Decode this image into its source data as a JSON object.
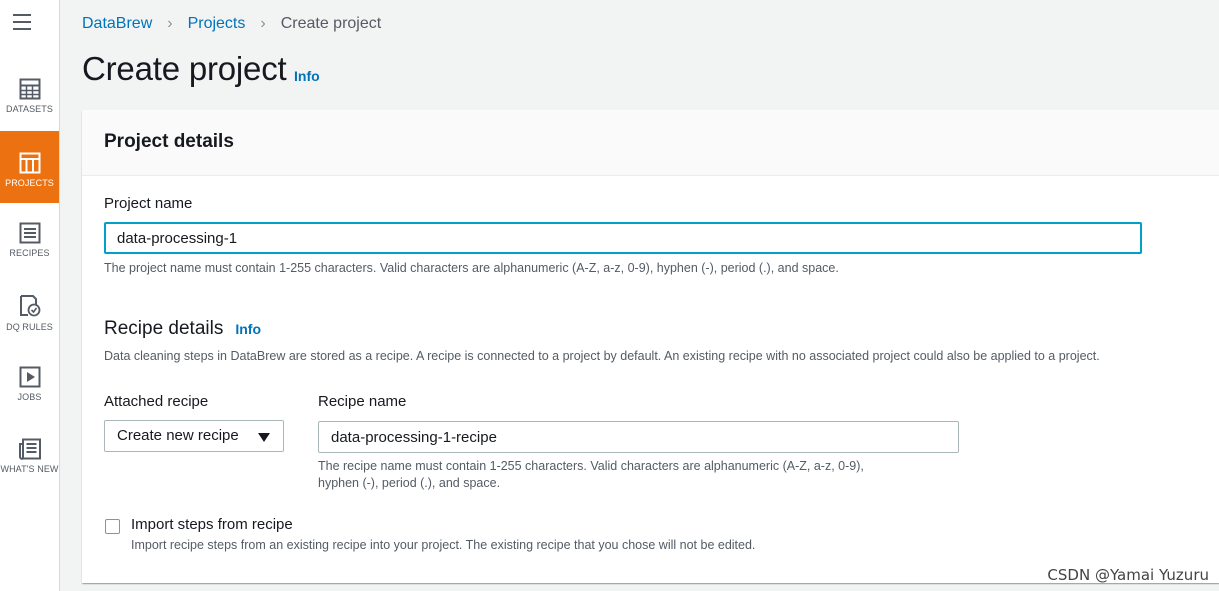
{
  "nav": {
    "items": [
      {
        "label": "DATASETS",
        "icon": "table-icon",
        "active": false
      },
      {
        "label": "PROJECTS",
        "icon": "grid-icon",
        "active": true
      },
      {
        "label": "RECIPES",
        "icon": "list-icon",
        "active": false
      },
      {
        "label": "DQ RULES",
        "icon": "rule-check-icon",
        "active": false
      },
      {
        "label": "JOBS",
        "icon": "play-icon",
        "active": false
      },
      {
        "label": "WHAT'S NEW",
        "icon": "newspaper-icon",
        "active": false
      }
    ],
    "active_color": "#ec7211"
  },
  "breadcrumb": {
    "items": [
      "DataBrew",
      "Projects"
    ],
    "current": "Create project"
  },
  "page": {
    "title": "Create project",
    "info_label": "Info"
  },
  "project_details": {
    "header": "Project details",
    "name_label": "Project name",
    "name_value": "data-processing-1",
    "name_hint": "The project name must contain 1-255 characters. Valid characters are alphanumeric (A-Z, a-z, 0-9), hyphen (-), period (.), and space."
  },
  "recipe_details": {
    "title": "Recipe details",
    "info_label": "Info",
    "description": "Data cleaning steps in DataBrew are stored as a recipe. A recipe is connected to a project by default. An existing recipe with no associated project could also be applied to a project.",
    "attached_label": "Attached recipe",
    "attached_value": "Create new recipe",
    "recipe_name_label": "Recipe name",
    "recipe_name_value": "data-processing-1-recipe",
    "recipe_hint_line1": "The recipe name must contain 1-255 characters. Valid characters are alphanumeric (A-Z, a-z, 0-9),",
    "recipe_hint_line2": "hyphen (-), period (.), and space.",
    "import_label": "Import steps from recipe",
    "import_checked": false,
    "import_hint": "Import recipe steps from an existing recipe into your project. The existing recipe that you chose will not be edited."
  },
  "watermark": "CSDN @Yamai Yuzuru",
  "colors": {
    "link": "#0073bb",
    "focus": "#00a1c9",
    "accent": "#ec7211"
  }
}
